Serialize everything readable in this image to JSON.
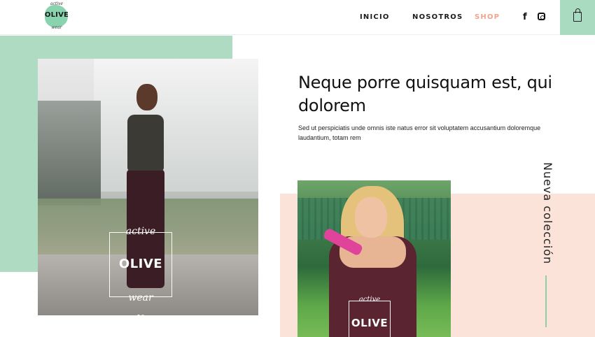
{
  "brand": {
    "logo_top": "active",
    "logo_text": "OLIVE",
    "logo_bottom": "wear"
  },
  "nav": {
    "items": [
      {
        "label": "INICIO"
      },
      {
        "label": "NOSOTROS"
      },
      {
        "label": "SHOP",
        "active": true
      }
    ],
    "active_color": "#f2a38c"
  },
  "social": {
    "facebook_glyph": "f",
    "icons": [
      "facebook-icon",
      "instagram-icon"
    ]
  },
  "cart": {
    "icon": "shopping-bag-icon",
    "accent": "#a8dbbf"
  },
  "hero": {
    "badge": {
      "top": "active",
      "brand": "OLIVE",
      "bottom": "wear"
    },
    "slides": 2,
    "active_slide": 1
  },
  "content": {
    "headline": "Neque porre quisquam est, qui dolorem",
    "body": "Sed ut perspiciatis unde omnis iste natus error sit voluptatem accusantium doloremque laudantium, totam rem"
  },
  "collection": {
    "badge": {
      "top": "active",
      "brand": "OLIVE"
    },
    "label": "Nueva colección"
  },
  "colors": {
    "green": "#aedbc1",
    "peach": "#fbe3da",
    "line": "#8fcfa5"
  }
}
